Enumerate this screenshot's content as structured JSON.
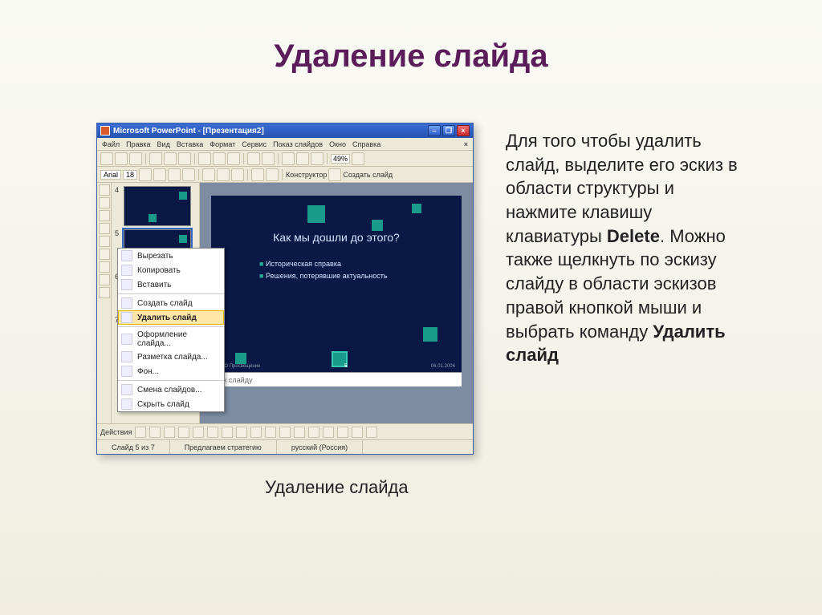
{
  "title": "Удаление слайда",
  "caption": "Удаление слайда",
  "description": {
    "part1": "Для того чтобы удалить слайд, выделите его эскиз в области структуры и нажмите клавишу клавиатуры ",
    "bold1": "Delete",
    "part2": ". Можно также щелкнуть по эскизу слайду в области эскизов правой кнопкой мыши и выбрать команду ",
    "bold2": "Удалить слайд"
  },
  "pp": {
    "window_title": "Microsoft PowerPoint - [Презентация2]",
    "menus": [
      "Файл",
      "Правка",
      "Вид",
      "Вставка",
      "Формат",
      "Сервис",
      "Показ слайдов",
      "Окно",
      "Справка"
    ],
    "font_name": "Arial",
    "font_size": "18",
    "zoom": "49%",
    "konstruktor": "Конструктор",
    "create_slide": "Создать слайд",
    "thumbs": [
      {
        "n": "4"
      },
      {
        "n": "5",
        "selected": true
      },
      {
        "n": "6"
      },
      {
        "n": "7"
      }
    ],
    "ctx": [
      "Вырезать",
      "Копировать",
      "Вставить",
      "Создать слайд",
      "Удалить слайд",
      "Оформление слайда...",
      "Разметка слайда...",
      "Фон...",
      "Смена слайдов...",
      "Скрыть слайд"
    ],
    "ctx_highlight_index": 4,
    "slide": {
      "title": "Как мы дошли до этого?",
      "bullets": [
        "Историческая справка",
        "Решения, потерявшие актуальность"
      ],
      "footer_left": "ОАО Просвещение",
      "page": "5",
      "footer_right": "06.01.2006"
    },
    "notes_placeholder": "ки к слайду",
    "actions_label": "Действия",
    "status": {
      "slide_of": "Слайд 5 из 7",
      "layout": "Предлагаем стратегию",
      "lang": "русский (Россия)"
    }
  }
}
